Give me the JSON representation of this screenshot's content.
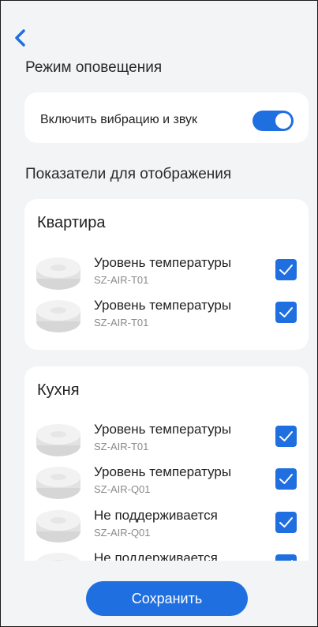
{
  "header": {
    "back_icon": "chevron-left-icon"
  },
  "notification_mode": {
    "title": "Режим оповещения",
    "toggle_label": "Включить вибрацию и звук",
    "toggle_on": true
  },
  "display_metrics": {
    "title": "Показатели для отображения",
    "groups": [
      {
        "name": "Квартира",
        "devices": [
          {
            "name": "Уровень температуры",
            "model": "SZ-AIR-T01",
            "checked": true
          },
          {
            "name": "Уровень температуры",
            "model": "SZ-AIR-T01",
            "checked": true
          }
        ]
      },
      {
        "name": "Кухня",
        "devices": [
          {
            "name": "Уровень температуры",
            "model": "SZ-AIR-T01",
            "checked": true
          },
          {
            "name": "Уровень температуры",
            "model": "SZ-AIR-Q01",
            "checked": true
          },
          {
            "name": "Не поддерживается",
            "model": "SZ-AIR-Q01",
            "checked": true
          },
          {
            "name": "Не поддерживается",
            "model": "",
            "checked": true
          }
        ]
      }
    ]
  },
  "actions": {
    "save_label": "Сохранить"
  },
  "colors": {
    "accent": "#1f6fe0",
    "background": "#f3f4f6",
    "card": "#ffffff"
  }
}
